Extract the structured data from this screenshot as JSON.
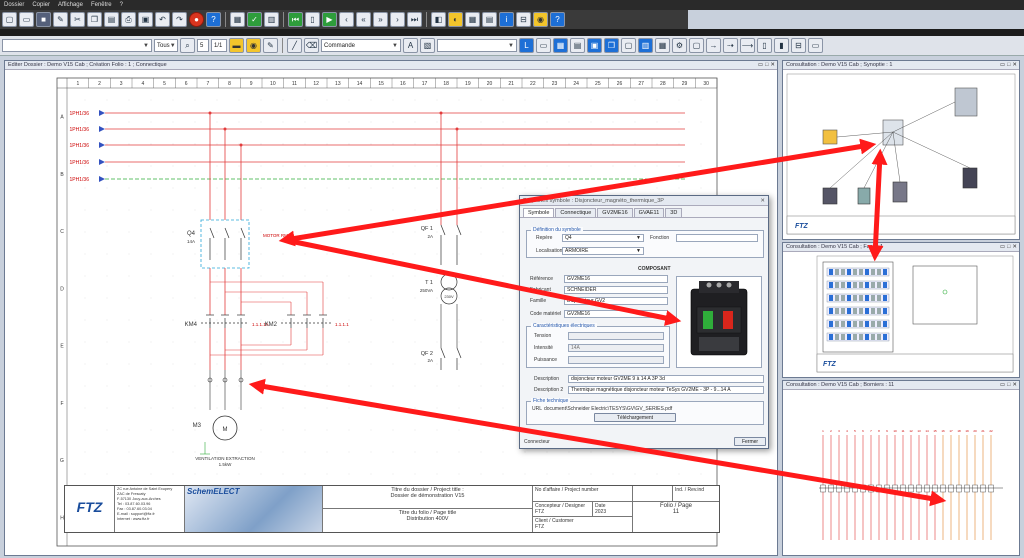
{
  "menu": {
    "items": [
      "Dossier",
      "Copier",
      "Affichage",
      "Fenêtre",
      "?"
    ]
  },
  "toolbar2": {
    "filter_value": "Tous",
    "page_num": "5",
    "page_of": "1/1",
    "command_combo": "Commande"
  },
  "main_window": {
    "title": "Editer Dossier : Demo V15 Cab ; Création Folio : 1 ; Connectique",
    "column_numbers": [
      "1",
      "2",
      "3",
      "4",
      "5",
      "6",
      "7",
      "8",
      "9",
      "10",
      "11",
      "12",
      "13",
      "14",
      "15",
      "16",
      "17",
      "18",
      "19",
      "20",
      "21",
      "22",
      "23",
      "24",
      "25",
      "26",
      "27",
      "28",
      "29",
      "30"
    ],
    "row_letters": [
      "A",
      "B",
      "C",
      "D",
      "E",
      "F",
      "G",
      "H"
    ],
    "wire_labels": [
      "1PH1/36",
      "1PH1/36",
      "1PH1/36",
      "1PH1/36",
      "1PH1/36"
    ],
    "q4_label": "Q4",
    "q4_rating": "14A",
    "q4_ref": "MOTOR RM",
    "km4_label": "KM4",
    "km1_label": "1.1.1.1A",
    "km2_label": "KM2",
    "km3_label": "1.1.1.1",
    "qf1_label": "QF 1",
    "qf1_rating": "2A",
    "t1_label": "T 1",
    "t1_rating": "250VA",
    "t1_volt": "230V",
    "qf2_label": "QF 2",
    "qf2_rating": "2A",
    "m3_label": "M3",
    "motor_caption": "VENTILATION EXTRACTION",
    "motor_power": "1.5kW"
  },
  "title_block": {
    "company_address": [
      "ZC rue Antoine de Saint Exupery",
      "ZAC de Frescaty",
      "F-57130 Jouy-aux-Arches",
      "Tel : 03.87.60.03.96",
      "Fax : 03.87.60.03.04",
      "E-mail : support@ftz.fr",
      "Internet : www.ftz.fr"
    ],
    "logo_text": "FTZ",
    "brand": "SchemELECT",
    "dossier_title_label": "Titre du dossier / Project title :",
    "dossier_title_value": "Dossier de démonstration V15",
    "folio_title_label": "Titre du folio / Page title",
    "folio_title_value": "Distribution 400V",
    "affaire_label": "No d'affaire / Project number",
    "concepteur_label": "Concepteur / Designer",
    "concepteur_value": "FTZ",
    "date_label": "Date",
    "date_value": "2023",
    "client_label": "Client / Customer",
    "client_value": "FTZ",
    "folio_page_label": "Folio / Page",
    "folio_page_value": "11",
    "ind_label": "Ind. / Rev.ind"
  },
  "cons1": {
    "title": "Consultation : Demo V15 Cab ; Synoptie : 1"
  },
  "cons2": {
    "title": "Consultation : Demo V15 Cab ; Face : 1"
  },
  "cons3": {
    "title": "Consultation : Demo V15 Cab ; Borniers : 11"
  },
  "dialog": {
    "title": "Propriétés symbole : Disjoncteur_magnéto_thermique_3P",
    "tabs": [
      "Symbole",
      "Connectique",
      "GV2ME16",
      "GVAE11",
      "3D"
    ],
    "group_def": "Définition du symbole",
    "repere_label": "Repère",
    "repere_value": "Q4",
    "fonction_label": "Fonction",
    "fonction_value": "",
    "localisation_label": "Localisation",
    "localisation_value": "ARMOIRE",
    "composant_label": "COMPOSANT",
    "reference_label": "Référence",
    "reference_value": "GV2ME16",
    "fabricant_label": "Fabricant",
    "fabricant_value": "SCHNEIDER",
    "famille_label": "Famille",
    "famille_value": "Disj. moteur GV2",
    "code_label": "Code matériel",
    "code_value": "GV2ME16",
    "group_elec": "Caractéristiques électriques",
    "tension_label": "Tension",
    "intensite_label": "Intensité",
    "intensite_value": "14A",
    "puissance_label": "Puissance",
    "description_label": "Description",
    "description_value": "disjoncteur moteur GV2ME 9 à 14 A 3P 3d",
    "description2_label": "Description 2",
    "description2_value": "Thermique magnétique disjoncteur moteur TeSys GV2ME - 3P - 9...14 A",
    "group_fiche": "Fiche technique",
    "url_label": "URL",
    "url_value": "document\\Schneider Electric\\TESYS\\GV\\GV_SERIES.pdf",
    "download_label": "Téléchargement",
    "connect_label": "Connecteur",
    "close_label": "Fermer"
  },
  "colors": {
    "accent_red": "#ff1a1a",
    "wire_red": "#e23b3b",
    "wire_green": "#2fae3a",
    "toolbar_dark": "#3a3a3a"
  }
}
